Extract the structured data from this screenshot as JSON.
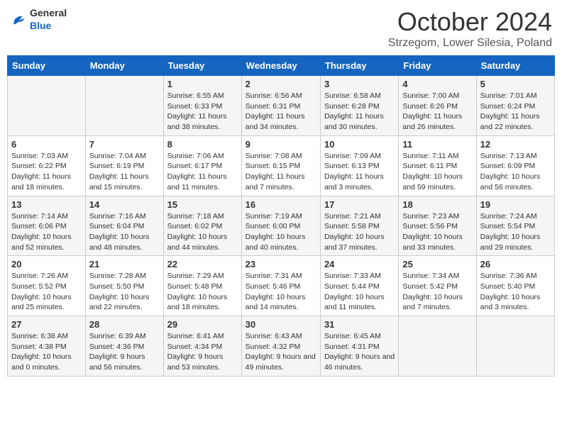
{
  "header": {
    "logo_general": "General",
    "logo_blue": "Blue",
    "month_title": "October 2024",
    "location": "Strzegom, Lower Silesia, Poland"
  },
  "days_of_week": [
    "Sunday",
    "Monday",
    "Tuesday",
    "Wednesday",
    "Thursday",
    "Friday",
    "Saturday"
  ],
  "weeks": [
    [
      {
        "day": "",
        "info": ""
      },
      {
        "day": "",
        "info": ""
      },
      {
        "day": "1",
        "info": "Sunrise: 6:55 AM\nSunset: 6:33 PM\nDaylight: 11 hours and 38 minutes."
      },
      {
        "day": "2",
        "info": "Sunrise: 6:56 AM\nSunset: 6:31 PM\nDaylight: 11 hours and 34 minutes."
      },
      {
        "day": "3",
        "info": "Sunrise: 6:58 AM\nSunset: 6:28 PM\nDaylight: 11 hours and 30 minutes."
      },
      {
        "day": "4",
        "info": "Sunrise: 7:00 AM\nSunset: 6:26 PM\nDaylight: 11 hours and 26 minutes."
      },
      {
        "day": "5",
        "info": "Sunrise: 7:01 AM\nSunset: 6:24 PM\nDaylight: 11 hours and 22 minutes."
      }
    ],
    [
      {
        "day": "6",
        "info": "Sunrise: 7:03 AM\nSunset: 6:22 PM\nDaylight: 11 hours and 18 minutes."
      },
      {
        "day": "7",
        "info": "Sunrise: 7:04 AM\nSunset: 6:19 PM\nDaylight: 11 hours and 15 minutes."
      },
      {
        "day": "8",
        "info": "Sunrise: 7:06 AM\nSunset: 6:17 PM\nDaylight: 11 hours and 11 minutes."
      },
      {
        "day": "9",
        "info": "Sunrise: 7:08 AM\nSunset: 6:15 PM\nDaylight: 11 hours and 7 minutes."
      },
      {
        "day": "10",
        "info": "Sunrise: 7:09 AM\nSunset: 6:13 PM\nDaylight: 11 hours and 3 minutes."
      },
      {
        "day": "11",
        "info": "Sunrise: 7:11 AM\nSunset: 6:11 PM\nDaylight: 10 hours and 59 minutes."
      },
      {
        "day": "12",
        "info": "Sunrise: 7:13 AM\nSunset: 6:09 PM\nDaylight: 10 hours and 56 minutes."
      }
    ],
    [
      {
        "day": "13",
        "info": "Sunrise: 7:14 AM\nSunset: 6:06 PM\nDaylight: 10 hours and 52 minutes."
      },
      {
        "day": "14",
        "info": "Sunrise: 7:16 AM\nSunset: 6:04 PM\nDaylight: 10 hours and 48 minutes."
      },
      {
        "day": "15",
        "info": "Sunrise: 7:18 AM\nSunset: 6:02 PM\nDaylight: 10 hours and 44 minutes."
      },
      {
        "day": "16",
        "info": "Sunrise: 7:19 AM\nSunset: 6:00 PM\nDaylight: 10 hours and 40 minutes."
      },
      {
        "day": "17",
        "info": "Sunrise: 7:21 AM\nSunset: 5:58 PM\nDaylight: 10 hours and 37 minutes."
      },
      {
        "day": "18",
        "info": "Sunrise: 7:23 AM\nSunset: 5:56 PM\nDaylight: 10 hours and 33 minutes."
      },
      {
        "day": "19",
        "info": "Sunrise: 7:24 AM\nSunset: 5:54 PM\nDaylight: 10 hours and 29 minutes."
      }
    ],
    [
      {
        "day": "20",
        "info": "Sunrise: 7:26 AM\nSunset: 5:52 PM\nDaylight: 10 hours and 25 minutes."
      },
      {
        "day": "21",
        "info": "Sunrise: 7:28 AM\nSunset: 5:50 PM\nDaylight: 10 hours and 22 minutes."
      },
      {
        "day": "22",
        "info": "Sunrise: 7:29 AM\nSunset: 5:48 PM\nDaylight: 10 hours and 18 minutes."
      },
      {
        "day": "23",
        "info": "Sunrise: 7:31 AM\nSunset: 5:46 PM\nDaylight: 10 hours and 14 minutes."
      },
      {
        "day": "24",
        "info": "Sunrise: 7:33 AM\nSunset: 5:44 PM\nDaylight: 10 hours and 11 minutes."
      },
      {
        "day": "25",
        "info": "Sunrise: 7:34 AM\nSunset: 5:42 PM\nDaylight: 10 hours and 7 minutes."
      },
      {
        "day": "26",
        "info": "Sunrise: 7:36 AM\nSunset: 5:40 PM\nDaylight: 10 hours and 3 minutes."
      }
    ],
    [
      {
        "day": "27",
        "info": "Sunrise: 6:38 AM\nSunset: 4:38 PM\nDaylight: 10 hours and 0 minutes."
      },
      {
        "day": "28",
        "info": "Sunrise: 6:39 AM\nSunset: 4:36 PM\nDaylight: 9 hours and 56 minutes."
      },
      {
        "day": "29",
        "info": "Sunrise: 6:41 AM\nSunset: 4:34 PM\nDaylight: 9 hours and 53 minutes."
      },
      {
        "day": "30",
        "info": "Sunrise: 6:43 AM\nSunset: 4:32 PM\nDaylight: 9 hours and 49 minutes."
      },
      {
        "day": "31",
        "info": "Sunrise: 6:45 AM\nSunset: 4:31 PM\nDaylight: 9 hours and 46 minutes."
      },
      {
        "day": "",
        "info": ""
      },
      {
        "day": "",
        "info": ""
      }
    ]
  ]
}
